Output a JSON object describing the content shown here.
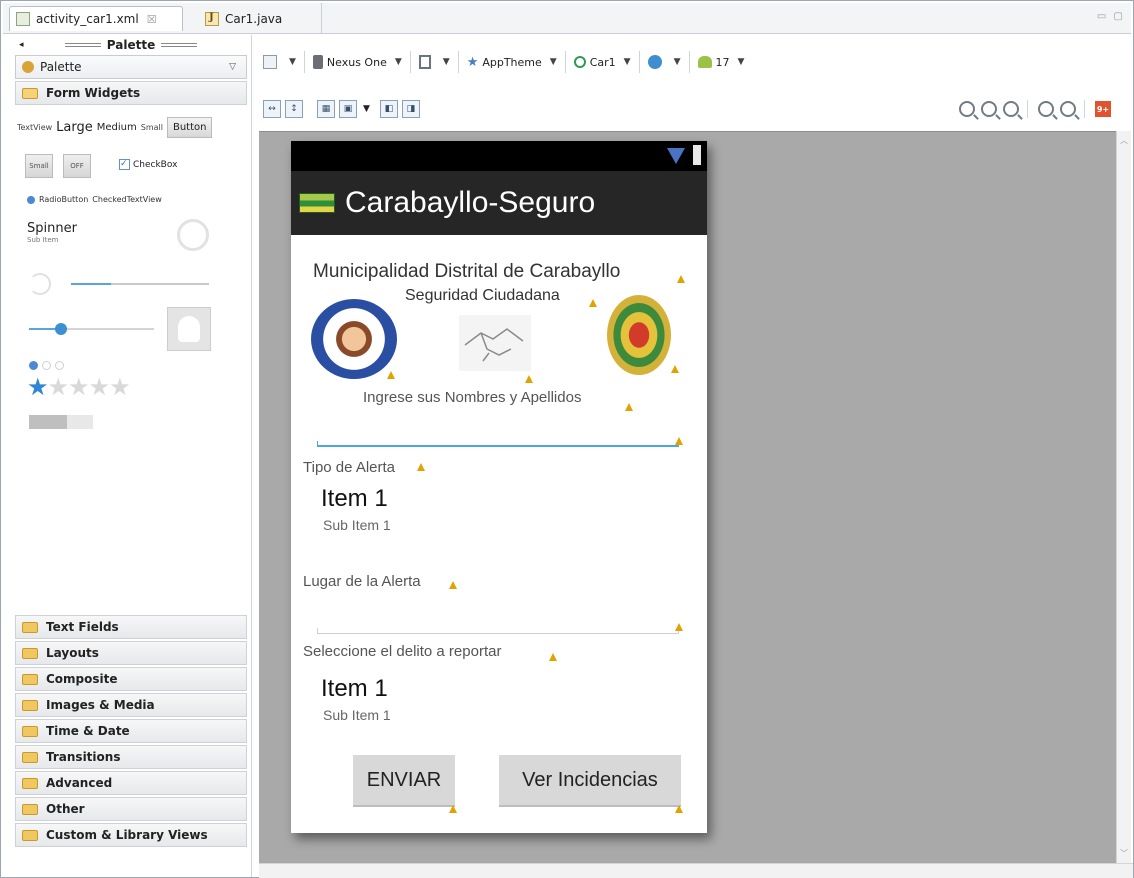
{
  "tabs": [
    {
      "label": "activity_car1.xml",
      "close": "☒"
    },
    {
      "label": "Car1.java"
    }
  ],
  "window_controls": "▭ ▢",
  "palette": {
    "header": "Palette",
    "combo_label": "Palette",
    "open_folder": "Form Widgets",
    "widgets": {
      "textview_small": "TextView",
      "large": "Large",
      "medium": "Medium",
      "small": "Small",
      "button": "Button",
      "toggle_small": "Small",
      "toggle_off": "OFF",
      "checkbox": "CheckBox",
      "radio": "RadioButton",
      "checked_textview": "CheckedTextView",
      "spinner": "Spinner",
      "spinner_sub": "Sub Item",
      "seekbar_level": 0.3,
      "rating_value": 1,
      "rating_max": 5,
      "progress_level": 0.6
    },
    "folders": [
      "Text Fields",
      "Layouts",
      "Composite",
      "Images & Media",
      "Time & Date",
      "Transitions",
      "Advanced",
      "Other",
      "Custom & Library Views"
    ]
  },
  "toolbar": {
    "device": "Nexus One",
    "theme": "AppTheme",
    "activity": "Car1",
    "api": "17"
  },
  "device_preview": {
    "app_title": "Carabayllo-Seguro",
    "heading": "Municipalidad Distrital de Carabayllo",
    "subheading": "Seguridad Ciudadana",
    "name_prompt": "Ingrese sus Nombres y Apellidos",
    "alert_type_label": "Tipo de Alerta",
    "spinner1": {
      "item": "Item 1",
      "sub": "Sub Item 1"
    },
    "alert_place_label": "Lugar de la Alerta",
    "crime_label": "Seleccione el delito a reportar",
    "spinner2": {
      "item": "Item 1",
      "sub": "Sub Item 1"
    },
    "send_button": "ENVIAR",
    "incidents_button": "Ver Incidencias"
  },
  "colors": {
    "canvas": "#a9a9a9",
    "actionbar": "#262626",
    "accent": "#4aa8dc",
    "warning": "#e0a400"
  }
}
